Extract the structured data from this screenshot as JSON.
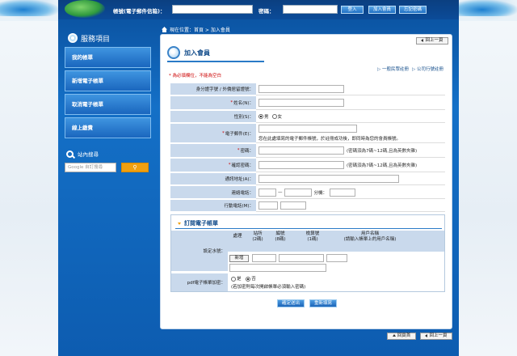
{
  "header": {
    "account_label": "帳號(電子郵件信箱)：",
    "password_label": "密碼：",
    "login_button": "登入",
    "join_button": "加入會員",
    "forgot_button": "忘記密碼"
  },
  "sidebar": {
    "title": "服務項目",
    "items": [
      {
        "label": "我的帳單"
      },
      {
        "label": "新增電子帳單"
      },
      {
        "label": "取消電子帳單"
      },
      {
        "label": "線上繳費"
      }
    ],
    "site_search_title": "站內搜尋",
    "search_placeholder": "Google 自訂搜尋",
    "search_button_icon": "magnify-icon"
  },
  "breadcrumb": {
    "text": "現在位置：首頁 > 加入會員"
  },
  "page": {
    "back_top_label": "回上一頁",
    "title": "加入會員",
    "link_general": "一般民眾註冊",
    "link_company": "公司行號註冊",
    "required_note": "* 為必填欄位，不能為空白"
  },
  "form": {
    "id_label": "身分證字號 / 外僑居留證號：",
    "name_label": "姓名(N)：",
    "gender_label": "性別(S)：",
    "gender_male": "男",
    "gender_female": "女",
    "email_label": "電子郵件(E)：",
    "email_hint": "您在此處填寫的電子郵件帳號，於註冊成功後，即同時為您的會員帳號。",
    "password_label": "密碼：",
    "password_hint": "(密碼須為7碼~12碼,且為英數夾雜)",
    "confirm_label": "確認密碼：",
    "confirm_hint": "(密碼須為7碼~12碼,且為英數夾雜)",
    "address_label": "通訊地址(A)：",
    "phone_label": "連絡電話：",
    "phone_dash": "—",
    "phone_ext": "分機：",
    "mobile_label": "行動電話(M)："
  },
  "subscribe": {
    "title": "訂閱電子帳單",
    "water_label": "設定水號：",
    "col_process": "處理",
    "col_station": "站所\n(2碼)",
    "col_number": "編號\n(8碼)",
    "col_check": "檢算號\n(1碼)",
    "col_user": "用戶名稱\n(請輸入帳單上的用戶名稱)",
    "add_button": "新增",
    "pdf_label": "pdf電子帳單加密：",
    "pdf_yes": "是",
    "pdf_no": "否",
    "pdf_hint": "(若加密則每次開啟帳單必須輸入密碼)"
  },
  "actions": {
    "confirm_button": "確定送出",
    "reset_button": "重新填寫"
  },
  "footer": {
    "top_button": "回頁首",
    "back_button": "回上一頁"
  },
  "colors": {
    "background": "#1470c7",
    "label_cell": "#c9d9ec",
    "required": "#cc0000",
    "accent": "#f0a010"
  }
}
